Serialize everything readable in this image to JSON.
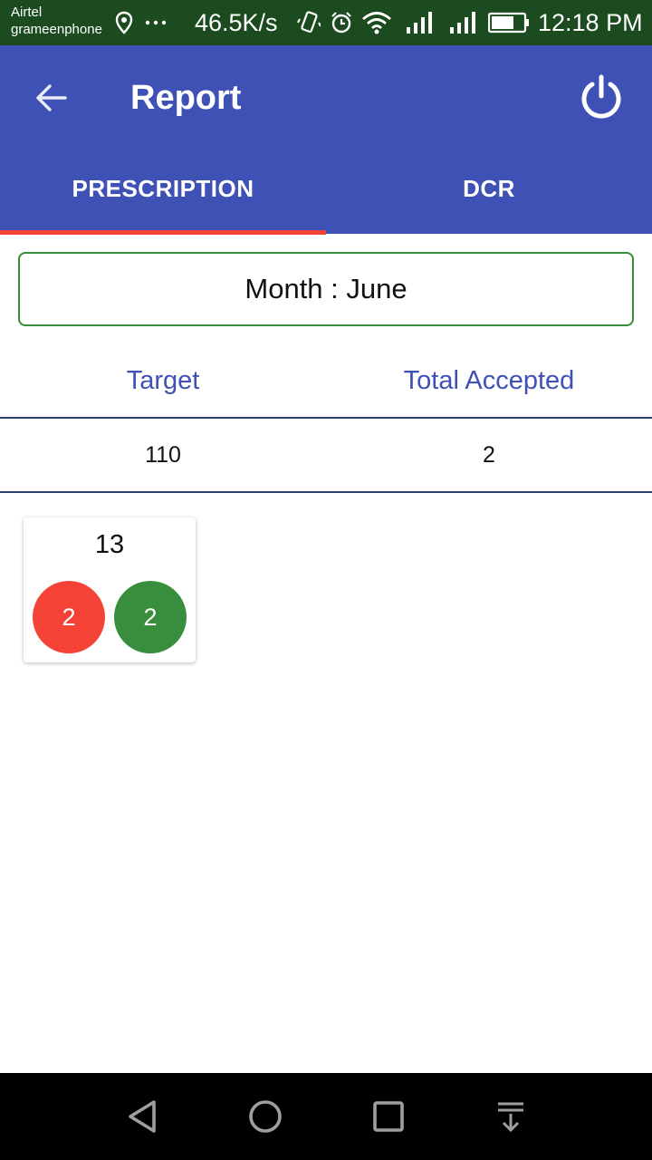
{
  "status_bar": {
    "carrier_1": "Airtel",
    "carrier_2": "grameenphone",
    "net_speed": "46.5K/s",
    "time": "12:18 PM",
    "icons": [
      "location-icon",
      "more-dots-icon",
      "vibrate-icon",
      "alarm-icon",
      "wifi-icon",
      "signal-icon",
      "signal-icon",
      "battery-icon"
    ]
  },
  "app_bar": {
    "title": "Report",
    "back_icon": "arrow-left-icon",
    "power_icon": "power-icon"
  },
  "tabs": [
    {
      "label": "PRESCRIPTION",
      "selected": true
    },
    {
      "label": "DCR",
      "selected": false
    }
  ],
  "month_selector": {
    "label": "Month : June"
  },
  "summary": {
    "headers": [
      "Target",
      "Total Accepted"
    ],
    "values": [
      "110",
      "2"
    ]
  },
  "cards": [
    {
      "number": "13",
      "red_count": "2",
      "green_count": "2"
    }
  ],
  "nav_bar": {
    "icons": [
      "back-triangle-icon",
      "home-circle-icon",
      "recents-square-icon",
      "notification-pull-icon"
    ]
  },
  "colors": {
    "primary": "#3f51b5",
    "status_bar": "#1b4b1f",
    "tab_indicator": "#f44336",
    "month_border": "#388e3c",
    "red_badge": "#f44336",
    "green_badge": "#388e3c",
    "header_text": "#3f51b5"
  }
}
